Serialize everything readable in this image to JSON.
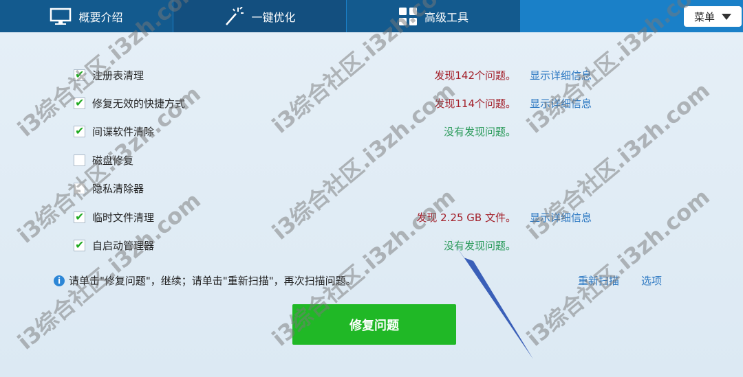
{
  "tabs": [
    {
      "label": "概要介绍",
      "icon": "monitor-icon"
    },
    {
      "label": "一键优化",
      "icon": "magic-wand-icon"
    },
    {
      "label": "高级工具",
      "icon": "grid-icon"
    }
  ],
  "menu": {
    "label": "菜单",
    "icon": "triangle-down-icon"
  },
  "items": [
    {
      "label": "注册表清理",
      "checked": true,
      "status": "发现142个问题。",
      "link": "显示详细信息"
    },
    {
      "label": "修复无效的快捷方式",
      "checked": true,
      "status": "发现114个问题。",
      "link": "显示详细信息"
    },
    {
      "label": "间谍软件清除",
      "checked": true,
      "status": "没有发现问题。",
      "link": ""
    },
    {
      "label": "磁盘修复",
      "checked": false,
      "status": "",
      "link": ""
    },
    {
      "label": "隐私清除器",
      "checked": false,
      "status": "",
      "link": ""
    },
    {
      "label": "临时文件清理",
      "checked": true,
      "status": "发现 2.25 GB 文件。",
      "link": "显示详细信息"
    },
    {
      "label": "自启动管理器",
      "checked": true,
      "status": "没有发现问题。",
      "link": ""
    }
  ],
  "info": {
    "icon": "info-icon",
    "text": "请单击\"修复问题\"，继续；请单击\"重新扫描\"，再次扫描问题。"
  },
  "actions": {
    "rescan": "重新扫描",
    "options": "选项"
  },
  "fix_button": "修复问题",
  "watermark": "i3综合社区.i3zh.com",
  "colors": {
    "tab_bar": "#1a80c8",
    "tab_dark": "#135a8e",
    "button_green": "#20b826",
    "warn_text": "#a3202a",
    "ok_text": "#2a9a5a",
    "link": "#2c78c2"
  }
}
